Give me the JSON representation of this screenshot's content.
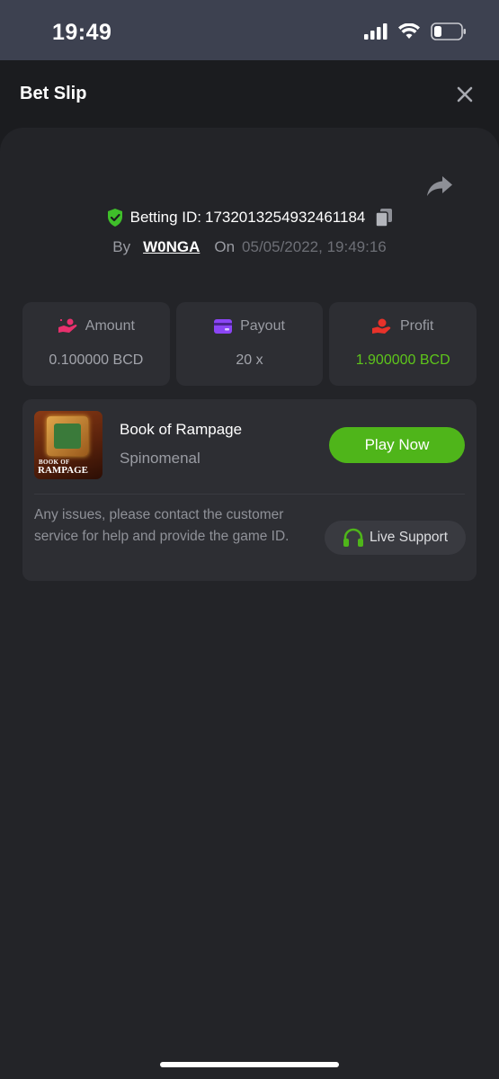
{
  "status_bar": {
    "time": "19:49"
  },
  "header": {
    "title": "Bet Slip"
  },
  "bet": {
    "id_label": "Betting ID:",
    "id_value": "1732013254932461184",
    "by_label": "By",
    "user": "W0NGA",
    "on_label": "On",
    "date": "05/05/2022, 19:49:16"
  },
  "stats": [
    {
      "label": "Amount",
      "value": "0.100000 BCD",
      "icon": "amount-hand-icon",
      "color": "#e8306d"
    },
    {
      "label": "Payout",
      "value": "20 x",
      "icon": "wallet-card-icon",
      "color": "#8b45f5"
    },
    {
      "label": "Profit",
      "value": "1.900000 BCD",
      "icon": "profit-hand-icon",
      "color": "#e8322a",
      "value_color": "#5ec51b"
    }
  ],
  "game": {
    "title": "Book of Rampage",
    "provider": "Spinomenal",
    "thumb_line1": "BOOK OF",
    "thumb_line2": "RAMPAGE",
    "play_label": "Play Now"
  },
  "support": {
    "notice": "Any issues, please contact the customer service for help and provide the game ID.",
    "button_label": "Live Support"
  },
  "colors": {
    "accent": "#4fb51a",
    "background": "#232428",
    "card": "#2d2e33"
  }
}
